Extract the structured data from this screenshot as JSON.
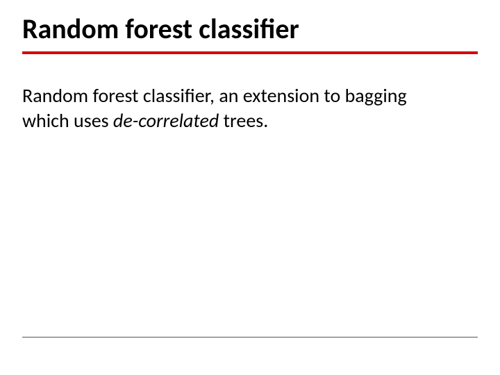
{
  "title": "Random forest classifier",
  "body": {
    "prefix": "Random forest classifier, an extension to bagging which uses ",
    "italic": "de-correlated",
    "suffix": " trees."
  },
  "colors": {
    "accent_rule": "#d90000",
    "bottom_rule": "#555555"
  }
}
